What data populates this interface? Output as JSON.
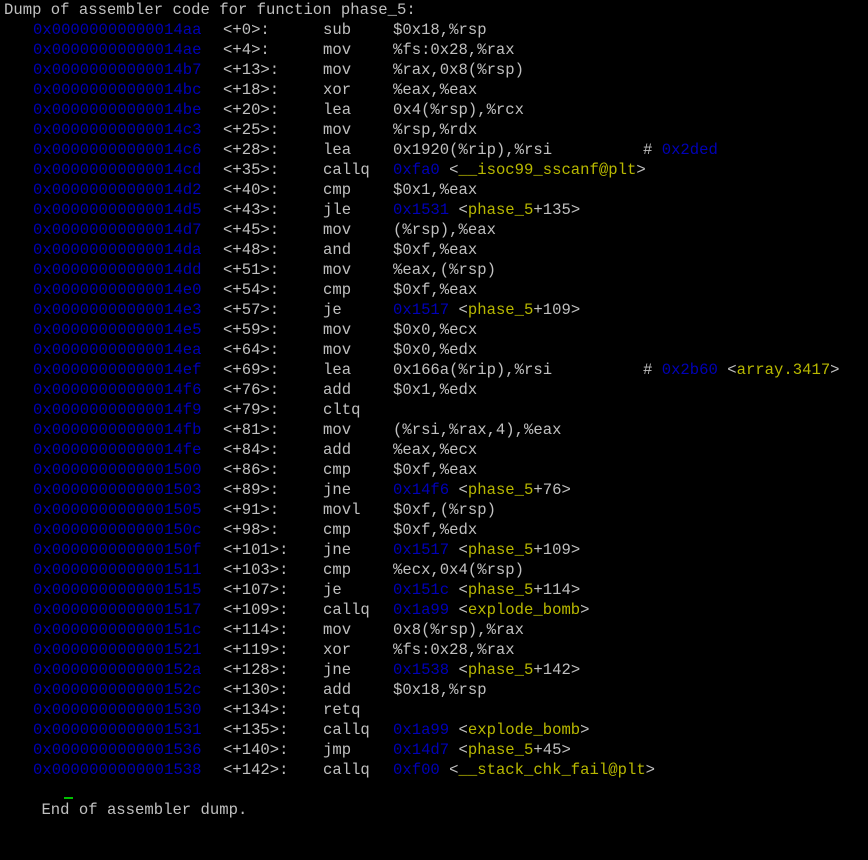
{
  "header": "Dump of assembler code for function phase_5:",
  "footer": "End of assembler dump.",
  "colors": {
    "text": "#c0c0c0",
    "addr": "#0000b8",
    "symbol": "#b8b800",
    "background": "#000000",
    "cursor": "#00c000"
  },
  "rows": [
    {
      "addr": "0x00000000000014aa",
      "off": "<+0>:",
      "mn": "sub",
      "ops": [
        {
          "t": "$0x18,%rsp"
        }
      ]
    },
    {
      "addr": "0x00000000000014ae",
      "off": "<+4>:",
      "mn": "mov",
      "ops": [
        {
          "t": "%fs:0x28,%rax"
        }
      ]
    },
    {
      "addr": "0x00000000000014b7",
      "off": "<+13>:",
      "mn": "mov",
      "ops": [
        {
          "t": "%rax,0x8(%rsp)"
        }
      ]
    },
    {
      "addr": "0x00000000000014bc",
      "off": "<+18>:",
      "mn": "xor",
      "ops": [
        {
          "t": "%eax,%eax"
        }
      ]
    },
    {
      "addr": "0x00000000000014be",
      "off": "<+20>:",
      "mn": "lea",
      "ops": [
        {
          "t": "0x4(%rsp),%rcx"
        }
      ]
    },
    {
      "addr": "0x00000000000014c3",
      "off": "<+25>:",
      "mn": "mov",
      "ops": [
        {
          "t": "%rsp,%rdx"
        }
      ]
    },
    {
      "addr": "0x00000000000014c6",
      "off": "<+28>:",
      "mn": "lea",
      "ops": [
        {
          "t": "0x1920(%rip),%rsi"
        }
      ],
      "cmt": [
        {
          "t": "# "
        },
        {
          "t": "0x2ded",
          "c": "a"
        }
      ]
    },
    {
      "addr": "0x00000000000014cd",
      "off": "<+35>:",
      "mn": "callq",
      "ops": [
        {
          "t": "0xfa0",
          "c": "a"
        },
        {
          "t": " <"
        },
        {
          "t": "__isoc99_sscanf@plt",
          "c": "s"
        },
        {
          "t": ">"
        }
      ]
    },
    {
      "addr": "0x00000000000014d2",
      "off": "<+40>:",
      "mn": "cmp",
      "ops": [
        {
          "t": "$0x1,%eax"
        }
      ]
    },
    {
      "addr": "0x00000000000014d5",
      "off": "<+43>:",
      "mn": "jle",
      "ops": [
        {
          "t": "0x1531",
          "c": "a"
        },
        {
          "t": " <"
        },
        {
          "t": "phase_5",
          "c": "s"
        },
        {
          "t": "+135>"
        }
      ]
    },
    {
      "addr": "0x00000000000014d7",
      "off": "<+45>:",
      "mn": "mov",
      "ops": [
        {
          "t": "(%rsp),%eax"
        }
      ]
    },
    {
      "addr": "0x00000000000014da",
      "off": "<+48>:",
      "mn": "and",
      "ops": [
        {
          "t": "$0xf,%eax"
        }
      ]
    },
    {
      "addr": "0x00000000000014dd",
      "off": "<+51>:",
      "mn": "mov",
      "ops": [
        {
          "t": "%eax,(%rsp)"
        }
      ]
    },
    {
      "addr": "0x00000000000014e0",
      "off": "<+54>:",
      "mn": "cmp",
      "ops": [
        {
          "t": "$0xf,%eax"
        }
      ]
    },
    {
      "addr": "0x00000000000014e3",
      "off": "<+57>:",
      "mn": "je",
      "ops": [
        {
          "t": "0x1517",
          "c": "a"
        },
        {
          "t": " <"
        },
        {
          "t": "phase_5",
          "c": "s"
        },
        {
          "t": "+109>"
        }
      ]
    },
    {
      "addr": "0x00000000000014e5",
      "off": "<+59>:",
      "mn": "mov",
      "ops": [
        {
          "t": "$0x0,%ecx"
        }
      ]
    },
    {
      "addr": "0x00000000000014ea",
      "off": "<+64>:",
      "mn": "mov",
      "ops": [
        {
          "t": "$0x0,%edx"
        }
      ]
    },
    {
      "addr": "0x00000000000014ef",
      "off": "<+69>:",
      "mn": "lea",
      "ops": [
        {
          "t": "0x166a(%rip),%rsi"
        }
      ],
      "cmt": [
        {
          "t": "# "
        },
        {
          "t": "0x2b60",
          "c": "a"
        },
        {
          "t": " <"
        },
        {
          "t": "array.3417",
          "c": "s"
        },
        {
          "t": ">"
        }
      ]
    },
    {
      "addr": "0x00000000000014f6",
      "off": "<+76>:",
      "mn": "add",
      "ops": [
        {
          "t": "$0x1,%edx"
        }
      ]
    },
    {
      "addr": "0x00000000000014f9",
      "off": "<+79>:",
      "mn": "cltq",
      "ops": []
    },
    {
      "addr": "0x00000000000014fb",
      "off": "<+81>:",
      "mn": "mov",
      "ops": [
        {
          "t": "(%rsi,%rax,4),%eax"
        }
      ]
    },
    {
      "addr": "0x00000000000014fe",
      "off": "<+84>:",
      "mn": "add",
      "ops": [
        {
          "t": "%eax,%ecx"
        }
      ]
    },
    {
      "addr": "0x0000000000001500",
      "off": "<+86>:",
      "mn": "cmp",
      "ops": [
        {
          "t": "$0xf,%eax"
        }
      ]
    },
    {
      "addr": "0x0000000000001503",
      "off": "<+89>:",
      "mn": "jne",
      "ops": [
        {
          "t": "0x14f6",
          "c": "a"
        },
        {
          "t": " <"
        },
        {
          "t": "phase_5",
          "c": "s"
        },
        {
          "t": "+76>"
        }
      ]
    },
    {
      "addr": "0x0000000000001505",
      "off": "<+91>:",
      "mn": "movl",
      "ops": [
        {
          "t": "$0xf,(%rsp)"
        }
      ]
    },
    {
      "addr": "0x000000000000150c",
      "off": "<+98>:",
      "mn": "cmp",
      "ops": [
        {
          "t": "$0xf,%edx"
        }
      ]
    },
    {
      "addr": "0x000000000000150f",
      "off": "<+101>:",
      "mn": "jne",
      "ops": [
        {
          "t": "0x1517",
          "c": "a"
        },
        {
          "t": " <"
        },
        {
          "t": "phase_5",
          "c": "s"
        },
        {
          "t": "+109>"
        }
      ]
    },
    {
      "addr": "0x0000000000001511",
      "off": "<+103>:",
      "mn": "cmp",
      "ops": [
        {
          "t": "%ecx,0x4(%rsp)"
        }
      ]
    },
    {
      "addr": "0x0000000000001515",
      "off": "<+107>:",
      "mn": "je",
      "ops": [
        {
          "t": "0x151c",
          "c": "a"
        },
        {
          "t": " <"
        },
        {
          "t": "phase_5",
          "c": "s"
        },
        {
          "t": "+114>"
        }
      ]
    },
    {
      "addr": "0x0000000000001517",
      "off": "<+109>:",
      "mn": "callq",
      "ops": [
        {
          "t": "0x1a99",
          "c": "a"
        },
        {
          "t": " <"
        },
        {
          "t": "explode_bomb",
          "c": "s"
        },
        {
          "t": ">"
        }
      ]
    },
    {
      "addr": "0x000000000000151c",
      "off": "<+114>:",
      "mn": "mov",
      "ops": [
        {
          "t": "0x8(%rsp),%rax"
        }
      ]
    },
    {
      "addr": "0x0000000000001521",
      "off": "<+119>:",
      "mn": "xor",
      "ops": [
        {
          "t": "%fs:0x28,%rax"
        }
      ]
    },
    {
      "addr": "0x000000000000152a",
      "off": "<+128>:",
      "mn": "jne",
      "ops": [
        {
          "t": "0x1538",
          "c": "a"
        },
        {
          "t": " <"
        },
        {
          "t": "phase_5",
          "c": "s"
        },
        {
          "t": "+142>"
        }
      ]
    },
    {
      "addr": "0x000000000000152c",
      "off": "<+130>:",
      "mn": "add",
      "ops": [
        {
          "t": "$0x18,%rsp"
        }
      ]
    },
    {
      "addr": "0x0000000000001530",
      "off": "<+134>:",
      "mn": "retq",
      "ops": []
    },
    {
      "addr": "0x0000000000001531",
      "off": "<+135>:",
      "mn": "callq",
      "ops": [
        {
          "t": "0x1a99",
          "c": "a"
        },
        {
          "t": " <"
        },
        {
          "t": "explode_bomb",
          "c": "s"
        },
        {
          "t": ">"
        }
      ]
    },
    {
      "addr": "0x0000000000001536",
      "off": "<+140>:",
      "mn": "jmp",
      "ops": [
        {
          "t": "0x14d7",
          "c": "a"
        },
        {
          "t": " <"
        },
        {
          "t": "phase_5",
          "c": "s"
        },
        {
          "t": "+45>"
        }
      ]
    },
    {
      "addr": "0x0000000000001538",
      "off": "<+142>:",
      "mn": "callq",
      "ops": [
        {
          "t": "0xf00",
          "c": "a"
        },
        {
          "t": " <"
        },
        {
          "t": "__stack_chk_fail@plt",
          "c": "s"
        },
        {
          "t": ">"
        }
      ]
    }
  ]
}
